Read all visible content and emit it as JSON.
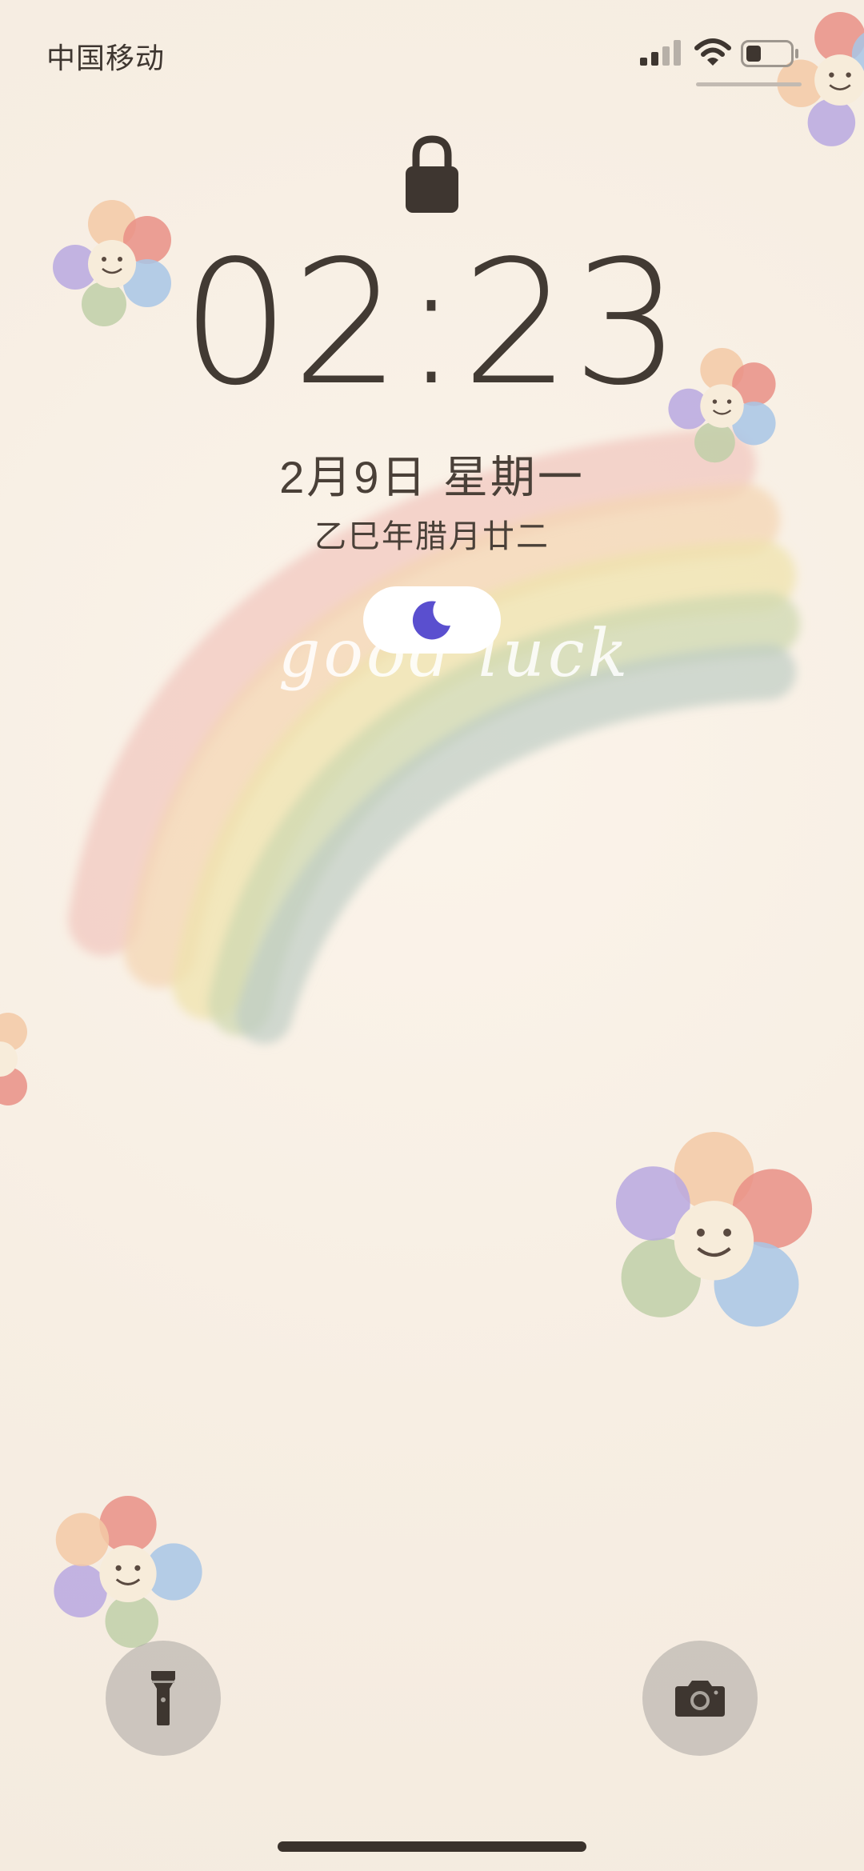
{
  "status_bar": {
    "carrier": "中国移动",
    "signal_icon": "cellular-signal-icon",
    "wifi_icon": "wifi-icon",
    "battery_icon": "battery-icon",
    "battery_level": 0.35
  },
  "lock_screen": {
    "lock_icon": "padlock-icon",
    "time": "02:23",
    "date": "2月9日 星期一",
    "lunar_date": "乙巳年腊月廿二",
    "focus_icon": "moon-icon",
    "focus_color": "#5a4fcf",
    "wallpaper_text": "good luck"
  },
  "quick_actions": {
    "flashlight_icon": "flashlight-icon",
    "camera_icon": "camera-icon"
  },
  "colors": {
    "background": "#f8f0e6",
    "text": "#423a33"
  }
}
